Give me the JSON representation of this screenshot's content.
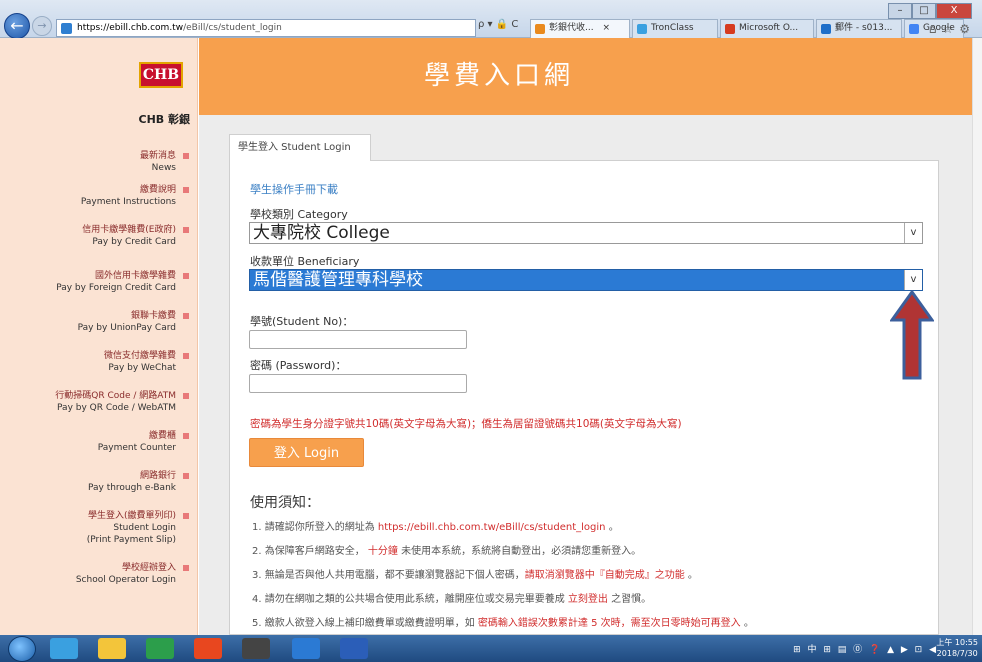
{
  "browser": {
    "url_host": "https://ebill.chb.com.tw",
    "url_path": "/eBill/cs/student_login",
    "addr_tools": "ρ ▾ 🔒 C",
    "tabs": [
      {
        "label": "彰銀代收...",
        "close": "×",
        "color": "#e98a1f"
      },
      {
        "label": "TronClass",
        "color": "#3aa0e0"
      },
      {
        "label": "Microsoft O...",
        "color": "#d63b1f"
      },
      {
        "label": "郵件 - s013...",
        "color": "#1f6fc9"
      },
      {
        "label": "Google",
        "color": "#4285f4"
      }
    ],
    "window_controls": [
      "–",
      "□",
      "X"
    ],
    "ie_icons": "⌂☆⚙"
  },
  "sidebar": {
    "logo": "CHB",
    "brand": "CHB 彰銀",
    "items": [
      {
        "zh": "最新消息",
        "en": "News"
      },
      {
        "zh": "繳費說明",
        "en": "Payment Instructions"
      },
      {
        "zh": "信用卡繳學雜費(E政府)",
        "en": "Pay by Credit Card"
      },
      {
        "zh": "國外信用卡繳學雜費",
        "en": "Pay by Foreign Credit Card"
      },
      {
        "zh": "銀聯卡繳費",
        "en": "Pay by UnionPay Card"
      },
      {
        "zh": "微信支付繳學雜費",
        "en": "Pay by WeChat"
      },
      {
        "zh": "行動掃碼QR Code / 網路ATM",
        "en": "Pay by QR Code / WebATM"
      },
      {
        "zh": "繳費櫃",
        "en": "Payment Counter"
      },
      {
        "zh": "網路銀行",
        "en": "Pay through e-Bank"
      },
      {
        "zh": "學生登入(繳費單列印)",
        "en": "Student Login",
        "en2": "(Print Payment Slip)"
      },
      {
        "zh": "學校經辦登入",
        "en": "School Operator Login"
      }
    ]
  },
  "header": {
    "title": "學費入口網"
  },
  "login": {
    "tab_label": "學生登入 Student Login",
    "manual_link": "學生操作手冊下載",
    "category_label": "學校類別 Category",
    "category_value": "大專院校 College",
    "beneficiary_label": "收款單位 Beneficiary",
    "beneficiary_value": "馬偕醫護管理專科學校",
    "student_no_label": "學號(Student No)：",
    "student_no_value": "",
    "password_label": "密碼 (Password)：",
    "password_value": "",
    "password_hint": "密碼為學生身分證字號共10碼(英文字母為大寫)；僑生為居留證號碼共10碼(英文字母為大寫)",
    "login_button": "登入 Login",
    "select_arrow": "v"
  },
  "notices": {
    "title": "使用須知：",
    "items": [
      {
        "a": "1. 請確認你所登入的網址為 ",
        "b": "https://ebill.chb.com.tw/eBill/cs/student_login",
        "c": " 。"
      },
      {
        "a": "2. 為保障客戶網路安全， ",
        "b": "十分鐘",
        "c": " 未使用本系統，系統將自動登出，必須請您重新登入。"
      },
      {
        "a": "3. 無論是否與他人共用電腦，都不要讓瀏覽器記下個人密碼，",
        "b": "請取消瀏覽器中『自動完成』之功能",
        "c": " 。"
      },
      {
        "a": "4. 請勿在網咖之類的公共場合使用此系統，離開座位或交易完畢要養成 ",
        "b": "立刻登出",
        "c": " 之習慣。"
      },
      {
        "a": "5. 繳款人欲登入線上補印繳費單或繳費證明單，如 ",
        "b": "密碼輸入錯誤次數累計達 5 次時，需至次日零時始可再登入",
        "c": " 。"
      }
    ]
  },
  "taskbar": {
    "tray": "⊞ 中 ⊞ ▤ ⓪ ❓ ▲ ▶ ⊡ ◀",
    "time": "上午 10:55",
    "date": "2018/7/30",
    "app_colors": [
      "#3aa0e0",
      "#f3c53a",
      "#2c9e4b",
      "#e8471f",
      "#444444",
      "#2b7ad4",
      "#2b5eb8"
    ]
  },
  "colors": {
    "accent": "#f7a04d",
    "sidebar_bg": "#fbe3d3",
    "hint_red": "#d12d2d",
    "arrow": "#b03434"
  }
}
